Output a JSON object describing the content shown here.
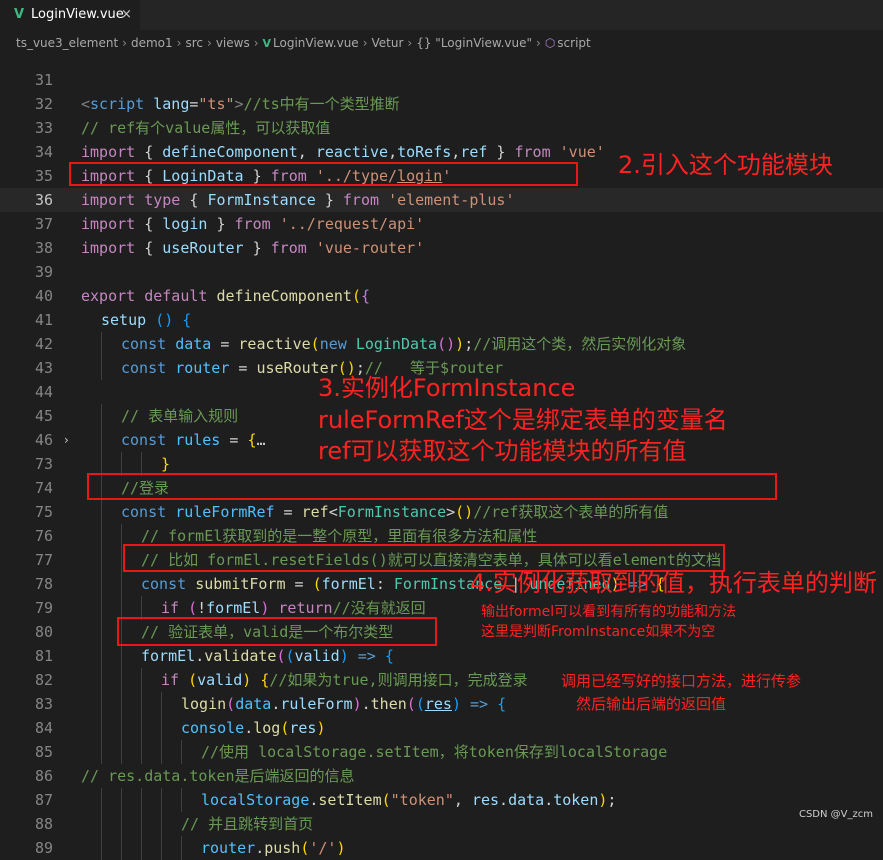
{
  "colors": {
    "editor_bg": "#1e1e1e",
    "keyword": "#c586c0",
    "storage": "#569cd6",
    "variable": "#9cdcfe",
    "function": "#dcdcaa",
    "type": "#4ec9b0",
    "string": "#ce9178",
    "comment": "#6a9955",
    "annotation": "#ff2222",
    "vue_icon": "#41b883"
  },
  "tab": {
    "icon": "vue-file-icon",
    "label": "LoginView.vue",
    "close": "×"
  },
  "breadcrumb": {
    "items": [
      "ts_vue3_element",
      "demo1",
      "src",
      "views",
      "LoginView.vue",
      "Vetur",
      "{} \"LoginView.vue\"",
      "script"
    ]
  },
  "code_lines": [
    {
      "number": "31",
      "tokens": []
    },
    {
      "number": "32",
      "tokens": [
        [
          "<",
          "#808080"
        ],
        [
          "script",
          "#569cd6"
        ],
        [
          " ",
          "#d4d4d4"
        ],
        [
          "lang",
          "#9cdcfe"
        ],
        [
          "=",
          "#d4d4d4"
        ],
        [
          "\"ts\"",
          "#ce9178"
        ],
        [
          ">",
          "#808080"
        ],
        [
          "//ts中有一个类型推断",
          "#6a9955"
        ]
      ]
    },
    {
      "number": "33",
      "tokens": [
        [
          "// ref有个value属性，可以获取值",
          "#6a9955"
        ]
      ]
    },
    {
      "number": "34",
      "tokens": [
        [
          "import",
          "#c586c0"
        ],
        [
          " { ",
          "#d4d4d4"
        ],
        [
          "defineComponent",
          "#9cdcfe"
        ],
        [
          ", ",
          "#d4d4d4"
        ],
        [
          "reactive",
          "#9cdcfe"
        ],
        [
          ",",
          "#d4d4d4"
        ],
        [
          "toRefs",
          "#9cdcfe"
        ],
        [
          ",",
          "#d4d4d4"
        ],
        [
          "ref",
          "#9cdcfe"
        ],
        [
          " } ",
          "#d4d4d4"
        ],
        [
          "from",
          "#c586c0"
        ],
        [
          " ",
          "#d4d4d4"
        ],
        [
          "'vue'",
          "#ce9178"
        ]
      ]
    },
    {
      "number": "35",
      "tokens": [
        [
          "import",
          "#c586c0"
        ],
        [
          " { ",
          "#d4d4d4"
        ],
        [
          "LoginData",
          "#9cdcfe"
        ],
        [
          " } ",
          "#d4d4d4"
        ],
        [
          "from",
          "#c586c0"
        ],
        [
          " ",
          "#d4d4d4"
        ],
        [
          "'../type/",
          "#ce9178"
        ],
        [
          "login",
          "#ce9178",
          "u"
        ],
        [
          "'",
          "#ce9178"
        ]
      ]
    },
    {
      "number": "36",
      "current": true,
      "tokens": [
        [
          "import",
          "#c586c0"
        ],
        [
          " ",
          "#d4d4d4"
        ],
        [
          "type",
          "#c586c0"
        ],
        [
          " { ",
          "#d4d4d4"
        ],
        [
          "FormInstance",
          "#9cdcfe"
        ],
        [
          " } ",
          "#d4d4d4"
        ],
        [
          "from",
          "#c586c0"
        ],
        [
          " ",
          "#d4d4d4"
        ],
        [
          "'element-plus'",
          "#ce9178"
        ]
      ]
    },
    {
      "number": "37",
      "tokens": [
        [
          "import",
          "#c586c0"
        ],
        [
          " { ",
          "#d4d4d4"
        ],
        [
          "login",
          "#9cdcfe"
        ],
        [
          " } ",
          "#d4d4d4"
        ],
        [
          "from",
          "#c586c0"
        ],
        [
          " ",
          "#d4d4d4"
        ],
        [
          "'../request/api'",
          "#ce9178"
        ]
      ]
    },
    {
      "number": "38",
      "tokens": [
        [
          "import",
          "#c586c0"
        ],
        [
          " { ",
          "#d4d4d4"
        ],
        [
          "useRouter",
          "#9cdcfe"
        ],
        [
          " } ",
          "#d4d4d4"
        ],
        [
          "from",
          "#c586c0"
        ],
        [
          " ",
          "#d4d4d4"
        ],
        [
          "'vue-router'",
          "#ce9178"
        ]
      ]
    },
    {
      "number": "39",
      "tokens": []
    },
    {
      "number": "40",
      "tokens": [
        [
          "export",
          "#c586c0"
        ],
        [
          " ",
          "#d4d4d4"
        ],
        [
          "default",
          "#c586c0"
        ],
        [
          " ",
          "#d4d4d4"
        ],
        [
          "defineComponent",
          "#dcdcaa"
        ],
        [
          "(",
          "#ffd700"
        ],
        [
          "{",
          "#da70d6"
        ]
      ]
    },
    {
      "number": "41",
      "indent": 1,
      "tokens": [
        [
          "setup",
          "#9cdcfe"
        ],
        [
          " ",
          "#d4d4d4"
        ],
        [
          "()",
          "#179fff"
        ],
        [
          " ",
          "#d4d4d4"
        ],
        [
          "{",
          "#179fff"
        ]
      ]
    },
    {
      "number": "42",
      "indent": 2,
      "tokens": [
        [
          "const",
          "#569cd6"
        ],
        [
          " ",
          "#d4d4d4"
        ],
        [
          "data",
          "#4fc1ff"
        ],
        [
          " = ",
          "#d4d4d4"
        ],
        [
          "reactive",
          "#dcdcaa"
        ],
        [
          "(",
          "#ffd700"
        ],
        [
          "new",
          "#569cd6"
        ],
        [
          " ",
          "#d4d4d4"
        ],
        [
          "LoginData",
          "#4ec9b0"
        ],
        [
          "()",
          "#da70d6"
        ],
        [
          ")",
          "#ffd700"
        ],
        [
          ";",
          "#d4d4d4"
        ],
        [
          "//调用这个类，然后实例化对象",
          "#6a9955"
        ]
      ]
    },
    {
      "number": "43",
      "indent": 2,
      "tokens": [
        [
          "const",
          "#569cd6"
        ],
        [
          " ",
          "#d4d4d4"
        ],
        [
          "router",
          "#4fc1ff"
        ],
        [
          " = ",
          "#d4d4d4"
        ],
        [
          "useRouter",
          "#dcdcaa"
        ],
        [
          "()",
          "#ffd700"
        ],
        [
          ";",
          "#d4d4d4"
        ],
        [
          "//   等于$router",
          "#6a9955"
        ]
      ]
    },
    {
      "number": "44",
      "tokens": []
    },
    {
      "number": "45",
      "indent": 2,
      "tokens": [
        [
          "// 表单输入规则",
          "#6a9955"
        ]
      ]
    },
    {
      "number": "46",
      "indent": 2,
      "fold": true,
      "tokens": [
        [
          "const",
          "#569cd6"
        ],
        [
          " ",
          "#d4d4d4"
        ],
        [
          "rules",
          "#4fc1ff"
        ],
        [
          " = ",
          "#d4d4d4"
        ],
        [
          "{",
          "#ffd700"
        ],
        [
          "…",
          "#d4d4d4"
        ]
      ]
    },
    {
      "number": "73",
      "indent": 4,
      "tokens": [
        [
          "}",
          "#ffd700"
        ]
      ]
    },
    {
      "number": "74",
      "indent": 2,
      "tokens": [
        [
          "//登录",
          "#6a9955"
        ]
      ]
    },
    {
      "number": "75",
      "indent": 2,
      "tokens": [
        [
          "const",
          "#569cd6"
        ],
        [
          " ",
          "#d4d4d4"
        ],
        [
          "ruleFormRef",
          "#4fc1ff"
        ],
        [
          " = ",
          "#d4d4d4"
        ],
        [
          "ref",
          "#dcdcaa"
        ],
        [
          "<",
          "#d4d4d4"
        ],
        [
          "FormInstance",
          "#4ec9b0"
        ],
        [
          ">",
          "#d4d4d4"
        ],
        [
          "()",
          "#ffd700"
        ],
        [
          "//ref获取这个表单的所有值",
          "#6a9955"
        ]
      ]
    },
    {
      "number": "76",
      "indent": 3,
      "tokens": [
        [
          "// formEl获取到的是一整个原型，里面有很多方法和属性",
          "#6a9955"
        ]
      ]
    },
    {
      "number": "77",
      "indent": 3,
      "tokens": [
        [
          "// 比如 formEl.resetFields()就可以直接清空表单，具体可以看element的文档",
          "#6a9955"
        ]
      ]
    },
    {
      "number": "78",
      "indent": 3,
      "tokens": [
        [
          "const",
          "#569cd6"
        ],
        [
          " ",
          "#d4d4d4"
        ],
        [
          "submitForm",
          "#dcdcaa"
        ],
        [
          " = ",
          "#d4d4d4"
        ],
        [
          "(",
          "#ffd700"
        ],
        [
          "formEl",
          "#9cdcfe"
        ],
        [
          ": ",
          "#d4d4d4"
        ],
        [
          "FormInstance",
          "#4ec9b0"
        ],
        [
          " | ",
          "#d4d4d4"
        ],
        [
          "undefined",
          "#4ec9b0"
        ],
        [
          ")",
          "#ffd700"
        ],
        [
          " ",
          "#d4d4d4"
        ],
        [
          "=>",
          "#569cd6"
        ],
        [
          " ",
          "#d4d4d4"
        ],
        [
          "{",
          "#ffd700"
        ]
      ]
    },
    {
      "number": "79",
      "indent": 4,
      "tokens": [
        [
          "if",
          "#c586c0"
        ],
        [
          " ",
          "#d4d4d4"
        ],
        [
          "(",
          "#da70d6"
        ],
        [
          "!",
          "#d4d4d4"
        ],
        [
          "formEl",
          "#9cdcfe"
        ],
        [
          ")",
          "#da70d6"
        ],
        [
          " ",
          "#d4d4d4"
        ],
        [
          "return",
          "#c586c0"
        ],
        [
          "//没有就返回",
          "#6a9955"
        ]
      ]
    },
    {
      "number": "80",
      "indent": 3,
      "tokens": [
        [
          "// 验证表单，valid是一个布尔类型",
          "#6a9955"
        ]
      ]
    },
    {
      "number": "81",
      "indent": 3,
      "tokens": [
        [
          "formEl",
          "#9cdcfe"
        ],
        [
          ".",
          "#d4d4d4"
        ],
        [
          "validate",
          "#dcdcaa"
        ],
        [
          "(",
          "#da70d6"
        ],
        [
          "(",
          "#179fff"
        ],
        [
          "valid",
          "#9cdcfe"
        ],
        [
          ")",
          "#179fff"
        ],
        [
          " ",
          "#d4d4d4"
        ],
        [
          "=>",
          "#569cd6"
        ],
        [
          " ",
          "#d4d4d4"
        ],
        [
          "{",
          "#179fff"
        ]
      ]
    },
    {
      "number": "82",
      "indent": 4,
      "tokens": [
        [
          "if",
          "#c586c0"
        ],
        [
          " ",
          "#d4d4d4"
        ],
        [
          "(",
          "#ffd700"
        ],
        [
          "valid",
          "#9cdcfe"
        ],
        [
          ")",
          "#ffd700"
        ],
        [
          " ",
          "#d4d4d4"
        ],
        [
          "{",
          "#ffd700"
        ],
        [
          "//如果为true,则调用接口，完成登录",
          "#6a9955"
        ]
      ]
    },
    {
      "number": "83",
      "indent": 5,
      "tokens": [
        [
          "login",
          "#dcdcaa"
        ],
        [
          "(",
          "#da70d6"
        ],
        [
          "data",
          "#4fc1ff"
        ],
        [
          ".",
          "#d4d4d4"
        ],
        [
          "ruleForm",
          "#9cdcfe"
        ],
        [
          ")",
          "#da70d6"
        ],
        [
          ".",
          "#d4d4d4"
        ],
        [
          "then",
          "#dcdcaa"
        ],
        [
          "(",
          "#da70d6"
        ],
        [
          "(",
          "#179fff"
        ],
        [
          "res",
          "#9cdcfe",
          "u"
        ],
        [
          ")",
          "#179fff"
        ],
        [
          " ",
          "#d4d4d4"
        ],
        [
          "=>",
          "#569cd6"
        ],
        [
          " ",
          "#d4d4d4"
        ],
        [
          "{",
          "#179fff"
        ]
      ]
    },
    {
      "number": "84",
      "indent": 5,
      "tokens": [
        [
          "console",
          "#4fc1ff"
        ],
        [
          ".",
          "#d4d4d4"
        ],
        [
          "log",
          "#dcdcaa"
        ],
        [
          "(",
          "#ffd700"
        ],
        [
          "res",
          "#9cdcfe"
        ],
        [
          ")",
          "#ffd700"
        ]
      ]
    },
    {
      "number": "85",
      "indent": 6,
      "tokens": [
        [
          "//使用 localStorage.setItem，将token保存到localStorage",
          "#6a9955"
        ]
      ]
    },
    {
      "number": "86",
      "tokens": [
        [
          "// res.data.token是后端返回的信息",
          "#6a9955"
        ]
      ]
    },
    {
      "number": "87",
      "indent": 6,
      "tokens": [
        [
          "localStorage",
          "#4fc1ff"
        ],
        [
          ".",
          "#d4d4d4"
        ],
        [
          "setItem",
          "#dcdcaa"
        ],
        [
          "(",
          "#ffd700"
        ],
        [
          "\"token\"",
          "#ce9178"
        ],
        [
          ", ",
          "#d4d4d4"
        ],
        [
          "res",
          "#9cdcfe"
        ],
        [
          ".",
          "#d4d4d4"
        ],
        [
          "data",
          "#9cdcfe"
        ],
        [
          ".",
          "#d4d4d4"
        ],
        [
          "token",
          "#9cdcfe"
        ],
        [
          ")",
          "#ffd700"
        ],
        [
          ";",
          "#d4d4d4"
        ]
      ]
    },
    {
      "number": "88",
      "indent": 5,
      "tokens": [
        [
          "// 并且跳转到首页",
          "#6a9955"
        ]
      ]
    },
    {
      "number": "89",
      "indent": 6,
      "tokens": [
        [
          "router",
          "#4fc1ff"
        ],
        [
          ".",
          "#d4d4d4"
        ],
        [
          "push",
          "#dcdcaa"
        ],
        [
          "(",
          "#ffd700"
        ],
        [
          "'/'",
          "#ce9178"
        ],
        [
          ")",
          "#ffd700"
        ]
      ]
    }
  ],
  "annotations": {
    "step2": "2.引入这个功能模块",
    "step3_title": "3.实例化FormInstance",
    "step3_line2": "ruleFormRef这个是绑定表单的变量名",
    "step3_line3": "ref可以获取这个功能模块的所有值",
    "step4": "4.实例化获取到的值，执行表单的判断",
    "note_formel_line1": "输出formel可以看到有所有的功能和方法",
    "note_formel_line2": "这里是判断FromInstance如果不为空",
    "note_login_line1": "调用已经写好的接口方法，进行传参",
    "note_login_line2": "然后输出后端的返回值"
  },
  "watermark": "CSDN @V_zcm"
}
